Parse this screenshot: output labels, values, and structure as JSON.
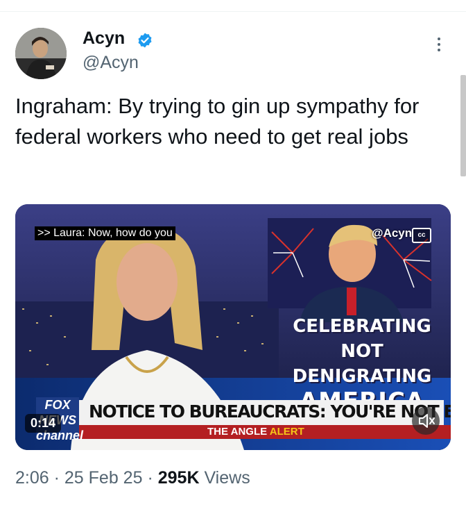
{
  "author": {
    "display_name": "Acyn",
    "handle": "@Acyn"
  },
  "tweet": {
    "text": "Ingraham: By trying to gin up sympathy for federal workers who need to get real jobs"
  },
  "video": {
    "caption": ">> Laura: Now, how do you",
    "watermark": "@Acyn",
    "cc_label": "cc",
    "graphic_line1": "CELEBRATING",
    "graphic_line2": "NOT DENIGRATING",
    "graphic_line3": "AMERICA",
    "chyron": "NOTICE TO BUREAUCRATS: YOU'RE NOT ENTITLED",
    "show_name": "THE ANGLE",
    "show_tag": "ALERT",
    "network_logo": "FOX NEWS channel",
    "time": "0:14"
  },
  "meta": {
    "time": "2:06",
    "date": "25 Feb 25",
    "views_count": "295K",
    "views_label": "Views",
    "separator": "·"
  },
  "icons": {
    "verified": "verified-badge-icon",
    "more": "more-options-icon",
    "mute": "muted-speaker-icon"
  },
  "colors": {
    "verified_blue": "#1d9bf0",
    "secondary_text": "#536471",
    "primary_text": "#0f1419"
  }
}
